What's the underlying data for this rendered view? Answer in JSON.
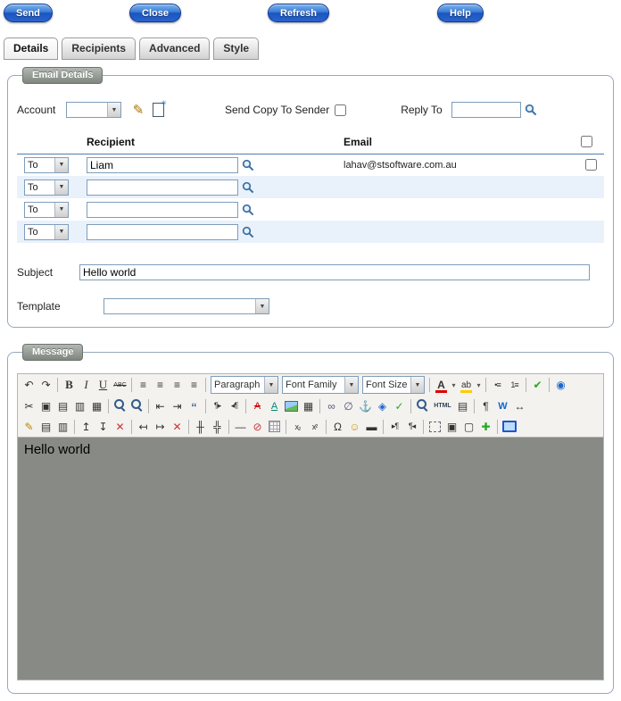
{
  "colors": {
    "button_blue": "#2a63cc",
    "row_alt": "#e9f1fb",
    "header_line": "#4f7cae",
    "editor_gray": "#888a85",
    "legend_gray": "#7e867e",
    "search_blue": "#3b6ea5"
  },
  "toolbar": {
    "send": "Send",
    "close": "Close",
    "refresh": "Refresh",
    "help": "Help"
  },
  "tabs": {
    "details": "Details",
    "recipients": "Recipients",
    "advanced": "Advanced",
    "style": "Style"
  },
  "email_details": {
    "legend": "Email Details",
    "account_label": "Account",
    "account_value": "",
    "edit_icon": "✎",
    "send_copy_label": "Send Copy To Sender",
    "reply_to_label": "Reply To",
    "reply_to_value": "",
    "table": {
      "recipient_header": "Recipient",
      "email_header": "Email",
      "rows": [
        {
          "to": "To",
          "recipient": "Liam",
          "email": "lahav@stsoftware.com.au"
        },
        {
          "to": "To",
          "recipient": "",
          "email": ""
        },
        {
          "to": "To",
          "recipient": "",
          "email": ""
        },
        {
          "to": "To",
          "recipient": "",
          "email": ""
        }
      ]
    },
    "subject_label": "Subject",
    "subject_value": "Hello world",
    "template_label": "Template",
    "template_value": ""
  },
  "message": {
    "legend": "Message",
    "content": "Hello world",
    "editor_rows": [
      [
        {
          "n": "undo-icon",
          "g": "↶"
        },
        {
          "n": "redo-icon",
          "g": "↷"
        },
        {
          "s": 1
        },
        {
          "n": "bold-icon",
          "g": "B",
          "c": "cb"
        },
        {
          "n": "italic-icon",
          "g": "I",
          "c": "ci"
        },
        {
          "n": "underline-icon",
          "g": "U",
          "c": "cu"
        },
        {
          "n": "strikethrough-icon",
          "g": "ABC",
          "c": "cs"
        },
        {
          "s": 1
        },
        {
          "n": "align-left-icon",
          "g": "≡"
        },
        {
          "n": "align-center-icon",
          "g": "≡"
        },
        {
          "n": "align-right-icon",
          "g": "≡"
        },
        {
          "n": "align-justify-icon",
          "g": "≡"
        },
        {
          "s": 1
        },
        {
          "sel": 1,
          "n": "paragraph-select",
          "g": "Paragraph",
          "w": 76
        },
        {
          "sel": 1,
          "n": "font-family-select",
          "g": "Font Family",
          "w": 86
        },
        {
          "sel": 1,
          "n": "font-size-select",
          "g": "Font Size",
          "w": 70
        },
        {
          "s": 1
        },
        {
          "n": "text-color-icon",
          "g": "A",
          "c": "fc"
        },
        {
          "n": "text-color-menu-icon",
          "g": "▾",
          "c": "nar"
        },
        {
          "n": "background-color-icon",
          "g": "ab",
          "c": "bc"
        },
        {
          "n": "background-color-menu-icon",
          "g": "▾",
          "c": "nar"
        },
        {
          "s": 1
        },
        {
          "n": "unordered-list-icon",
          "g": "•≡",
          "c": "sm"
        },
        {
          "n": "ordered-list-icon",
          "g": "1≡",
          "c": "sm"
        },
        {
          "s": 1
        },
        {
          "n": "spellcheck-icon",
          "g": "✔",
          "c": "cg"
        },
        {
          "s": 1
        },
        {
          "n": "globe-icon",
          "g": "◉",
          "c": "cbl"
        }
      ],
      [
        {
          "n": "cut-icon",
          "g": "✂"
        },
        {
          "n": "copy-icon",
          "g": "▣"
        },
        {
          "n": "paste-icon",
          "g": "▤"
        },
        {
          "n": "paste-text-icon",
          "g": "▥"
        },
        {
          "n": "paste-word-icon",
          "g": "▦"
        },
        {
          "s": 1
        },
        {
          "n": "find-icon",
          "c": "g-mag"
        },
        {
          "n": "find-replace-icon",
          "c": "g-mag"
        },
        {
          "s": 1
        },
        {
          "n": "outdent-icon",
          "g": "⇤"
        },
        {
          "n": "indent-icon",
          "g": "⇥"
        },
        {
          "n": "blockquote-icon",
          "g": "“",
          "c": "cq"
        },
        {
          "s": 1
        },
        {
          "n": "ltr-icon",
          "g": "¶▸",
          "c": "sm"
        },
        {
          "n": "rtl-icon",
          "g": "◂¶",
          "c": "sm"
        },
        {
          "s": 1
        },
        {
          "n": "deleted-text-icon",
          "g": "A",
          "c": "cdel"
        },
        {
          "n": "inserted-text-icon",
          "g": "A",
          "c": "cins"
        },
        {
          "n": "image-icon",
          "c": "g-img"
        },
        {
          "n": "date-icon",
          "g": "▦"
        },
        {
          "s": 1
        },
        {
          "n": "link-icon",
          "g": "∞",
          "c": "clk"
        },
        {
          "n": "unlink-icon",
          "g": "∅",
          "c": "clk"
        },
        {
          "n": "anchor-icon",
          "g": "⚓"
        },
        {
          "n": "embed-icon",
          "g": "◈",
          "c": "cbl"
        },
        {
          "n": "shield-icon",
          "g": "✓",
          "c": "cg"
        },
        {
          "s": 1
        },
        {
          "n": "preview-icon",
          "c": "g-mag"
        },
        {
          "n": "html-icon",
          "g": "HTML",
          "c": "ht"
        },
        {
          "n": "print-icon",
          "g": "▤"
        },
        {
          "s": 1
        },
        {
          "n": "visual-chars-icon",
          "g": "¶"
        },
        {
          "n": "word-doc-icon",
          "g": "W",
          "c": "cw"
        },
        {
          "n": "resize-icon",
          "g": "↔"
        }
      ],
      [
        {
          "n": "style-props-icon",
          "g": "✎",
          "c": "cy"
        },
        {
          "n": "table-row-props-icon",
          "g": "▤"
        },
        {
          "n": "table-cell-props-icon",
          "g": "▥"
        },
        {
          "s": 1
        },
        {
          "n": "insert-row-before-icon",
          "g": "↥"
        },
        {
          "n": "insert-row-after-icon",
          "g": "↧"
        },
        {
          "n": "delete-row-icon",
          "g": "✕",
          "c": "cr"
        },
        {
          "s": 1
        },
        {
          "n": "insert-col-before-icon",
          "g": "↤"
        },
        {
          "n": "insert-col-after-icon",
          "g": "↦"
        },
        {
          "n": "delete-col-icon",
          "g": "✕",
          "c": "cr"
        },
        {
          "s": 1
        },
        {
          "n": "split-cells-icon",
          "g": "╫"
        },
        {
          "n": "merge-cells-icon",
          "g": "╬"
        },
        {
          "s": 1
        },
        {
          "n": "hr-icon",
          "g": "—"
        },
        {
          "n": "remove-format-icon",
          "g": "⊘",
          "c": "cr"
        },
        {
          "n": "visual-aid-icon",
          "c": "g-grid"
        },
        {
          "s": 1
        },
        {
          "n": "subscript-icon",
          "g": "x₂",
          "c": "sm"
        },
        {
          "n": "superscript-icon",
          "g": "x²",
          "c": "sm"
        },
        {
          "s": 1
        },
        {
          "n": "charmap-icon",
          "g": "Ω"
        },
        {
          "n": "emotions-icon",
          "g": "☺",
          "c": "cy2"
        },
        {
          "n": "media-icon",
          "g": "▬"
        },
        {
          "s": 1
        },
        {
          "n": "pagebreak-icon",
          "g": "▸¶",
          "c": "sm"
        },
        {
          "n": "nonbreaking-icon",
          "g": "¶◂",
          "c": "sm"
        },
        {
          "s": 1
        },
        {
          "n": "selection-icon",
          "c": "g-dash"
        },
        {
          "n": "bring-forward-icon",
          "g": "▣"
        },
        {
          "n": "send-backward-icon",
          "g": "▢"
        },
        {
          "n": "insert-layer-icon",
          "g": "✚",
          "c": "cg"
        },
        {
          "s": 1
        },
        {
          "n": "fullscreen-icon",
          "c": "g-mon"
        }
      ]
    ]
  }
}
